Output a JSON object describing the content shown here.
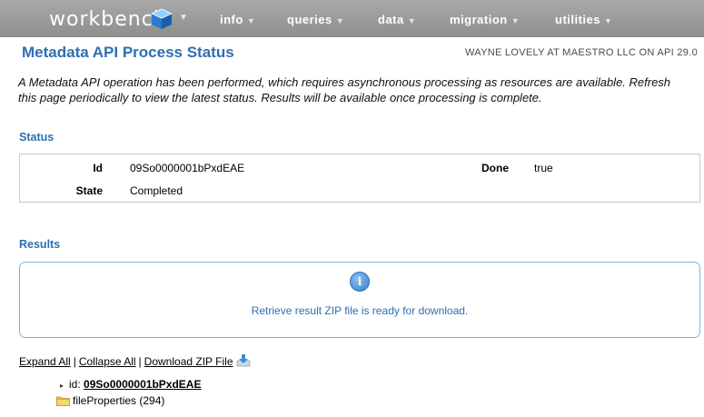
{
  "nav": {
    "logo": "workbench",
    "menu": [
      {
        "label": "info"
      },
      {
        "label": "queries"
      },
      {
        "label": "data"
      },
      {
        "label": "migration"
      },
      {
        "label": "utilities"
      }
    ]
  },
  "header": {
    "title": "Metadata API Process Status",
    "user_info": "WAYNE LOVELY AT MAESTRO LLC ON API 29.0"
  },
  "intro": "A Metadata API operation has been performed, which requires asynchronous processing as resources are available. Refresh this page periodically to view the latest status. Results will be available once processing is complete.",
  "status": {
    "section_title": "Status",
    "id_label": "Id",
    "id_value": "09So0000001bPxdEAE",
    "done_label": "Done",
    "done_value": "true",
    "state_label": "State",
    "state_value": "Completed"
  },
  "results": {
    "section_title": "Results",
    "info_glyph": "i",
    "message": "Retrieve result ZIP file is ready for download.",
    "expand_all": "Expand All",
    "collapse_all": "Collapse All",
    "download_zip": "Download ZIP File",
    "separator": "|",
    "tree": {
      "id_prefix": "id:",
      "id_value": "09So0000001bPxdEAE",
      "folder_label": "fileProperties (294)"
    }
  },
  "colors": {
    "nav_bg": "#999999",
    "title_blue": "#2c6fb3",
    "box_border_blue": "#7fb3e0"
  }
}
